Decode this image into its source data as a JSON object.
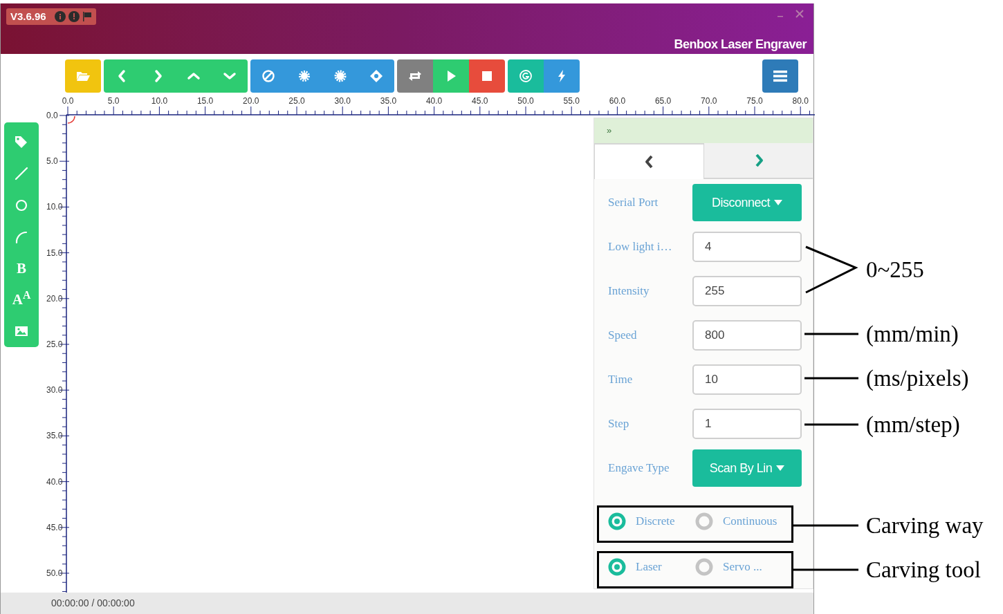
{
  "app": {
    "version": "V3.6.96",
    "title": "Benbox Laser Engraver"
  },
  "ruler": {
    "x_labels": [
      "0.0",
      "5.0",
      "10.0",
      "15.0",
      "20.0",
      "25.0",
      "30.0",
      "35.0",
      "40.0",
      "45.0",
      "50.0",
      "55.0",
      "60.0",
      "65.0",
      "70.0",
      "75.0",
      "80.0"
    ],
    "y_labels": [
      "0.0",
      "5.0",
      "10.0",
      "15.0",
      "20.0",
      "25.0",
      "30.0",
      "35.0",
      "40.0",
      "45.0",
      "50.0"
    ]
  },
  "tools": [
    {
      "kind": "tag"
    },
    {
      "kind": "line"
    },
    {
      "kind": "circle"
    },
    {
      "kind": "arc"
    },
    {
      "kind": "glyph",
      "glyph": "B"
    },
    {
      "kind": "glyph",
      "glyph": "A$^{A}$"
    },
    {
      "kind": "image"
    }
  ],
  "panel": {
    "collapse": "»",
    "tabs": [
      {
        "selected": true
      },
      {
        "selected": false
      }
    ],
    "fields": [
      {
        "label": "Serial Port",
        "kind": "dropdown",
        "value": "Disconnect"
      },
      {
        "label": "Low light i…",
        "kind": "input",
        "value": "4"
      },
      {
        "label": "Intensity",
        "kind": "input",
        "value": "255"
      },
      {
        "label": "Speed",
        "kind": "input",
        "value": "800"
      },
      {
        "label": "Time",
        "kind": "input",
        "value": "10"
      },
      {
        "label": "Step",
        "kind": "input",
        "value": "1"
      },
      {
        "label": "Engave Type",
        "kind": "dropdown",
        "value": "Scan By Lin"
      }
    ],
    "radio_groups": [
      {
        "options": [
          {
            "label": "Discrete",
            "selected": true
          },
          {
            "label": "Continuous",
            "selected": false
          }
        ]
      },
      {
        "options": [
          {
            "label": "Laser",
            "selected": true
          },
          {
            "label": "Servo ...",
            "selected": false
          }
        ]
      }
    ]
  },
  "status_bar": {
    "time": "00:00:00 / 00:00:00"
  },
  "annotations": [
    {
      "kind": "bracket",
      "text": "0~255"
    },
    {
      "kind": "line",
      "text": "(mm/min)"
    },
    {
      "kind": "line",
      "text": "(ms/pixels)"
    },
    {
      "kind": "line",
      "text": "(mm/step)"
    },
    {
      "kind": "boxed",
      "text": "Carving way"
    },
    {
      "kind": "boxed",
      "text": "Carving tool"
    }
  ]
}
